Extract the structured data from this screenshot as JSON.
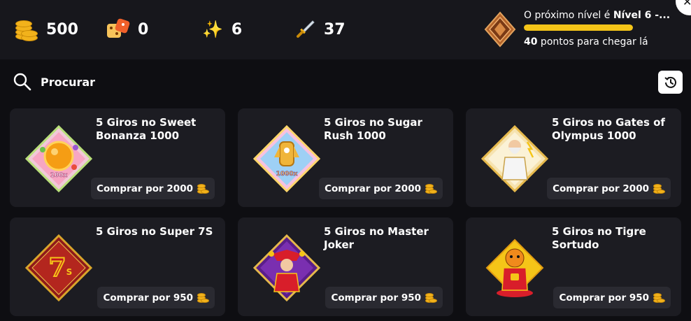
{
  "stats": {
    "coins": "500",
    "dice": "0",
    "sparkles": "6",
    "swords": "37"
  },
  "level": {
    "title_prefix": "O próximo nível é ",
    "title_level": "Nível 6 -...",
    "progress_fraction": 1.0,
    "points": "40",
    "points_suffix": " pontos para chegar lá"
  },
  "search": {
    "label": "Procurar"
  },
  "cards": [
    {
      "title": "5 Giros no Sweet Bonanza 1000",
      "buy_label": "Comprar por 2000",
      "art_icon": "sweet-bonanza-icon",
      "art_text": "100x"
    },
    {
      "title": "5 Giros no Sugar Rush 1000",
      "buy_label": "Comprar por 2000",
      "art_icon": "sugar-rush-icon",
      "art_text": "1000x"
    },
    {
      "title": "5 Giros no Gates of Olympus 1000",
      "buy_label": "Comprar por 2000",
      "art_icon": "gates-of-olympus-icon"
    },
    {
      "title": "5 Giros no Super 7S",
      "buy_label": "Comprar por 950",
      "art_icon": "super-7s-icon"
    },
    {
      "title": "5 Giros no Master Joker",
      "buy_label": "Comprar por 950",
      "art_icon": "master-joker-icon"
    },
    {
      "title": "5 Giros no Tigre Sortudo",
      "buy_label": "Comprar por 950",
      "art_icon": "tigre-sortudo-icon"
    }
  ],
  "colors": {
    "accent_yellow": "#f5c518",
    "card_bg": "#1c1c22",
    "page_bg": "#0e0e12"
  }
}
